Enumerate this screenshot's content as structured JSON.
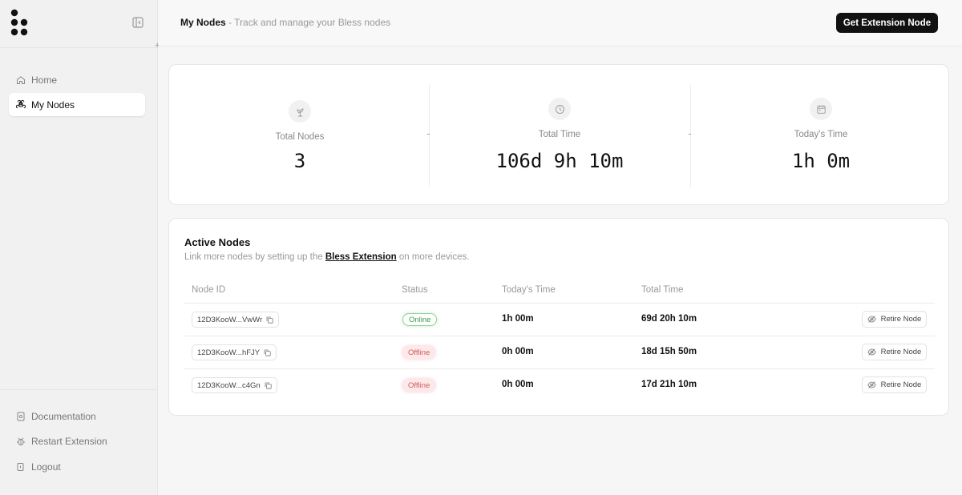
{
  "sidebar": {
    "nav": [
      {
        "label": "Home",
        "icon": "home-icon"
      },
      {
        "label": "My Nodes",
        "icon": "command-icon"
      }
    ],
    "bottom": [
      {
        "label": "Documentation",
        "icon": "document-icon"
      },
      {
        "label": "Restart Extension",
        "icon": "bug-icon"
      },
      {
        "label": "Logout",
        "icon": "logout-icon"
      }
    ]
  },
  "header": {
    "title": "My Nodes",
    "description": " - Track and manage your Bless nodes",
    "cta_label": "Get Extension Node"
  },
  "stats": [
    {
      "label": "Total Nodes",
      "value": "3",
      "icon": "sprout-icon"
    },
    {
      "label": "Total Time",
      "value": "106d 9h 10m",
      "icon": "clock-icon"
    },
    {
      "label": "Today's Time",
      "value": "1h 0m",
      "icon": "calendar-icon"
    }
  ],
  "active_nodes": {
    "title": "Active Nodes",
    "subtitle_prefix": "Link more nodes by setting up the ",
    "subtitle_link": "Bless Extension",
    "subtitle_suffix": " on more devices.",
    "columns": [
      "Node ID",
      "Status",
      "Today's Time",
      "Total Time"
    ],
    "retire_label": "Retire Node",
    "rows": [
      {
        "id": "12D3KooW...VwWr",
        "status": "Online",
        "today": "1h 00m",
        "total": "69d 20h 10m"
      },
      {
        "id": "12D3KooW...hFJY",
        "status": "Offline",
        "today": "0h 00m",
        "total": "18d 15h 50m"
      },
      {
        "id": "12D3KooW...c4Gn",
        "status": "Offline",
        "today": "0h 00m",
        "total": "17d 21h 10m"
      }
    ]
  },
  "colors": {
    "accent": "#111111",
    "online": "#3b9a4b",
    "offline": "#d45b62"
  }
}
